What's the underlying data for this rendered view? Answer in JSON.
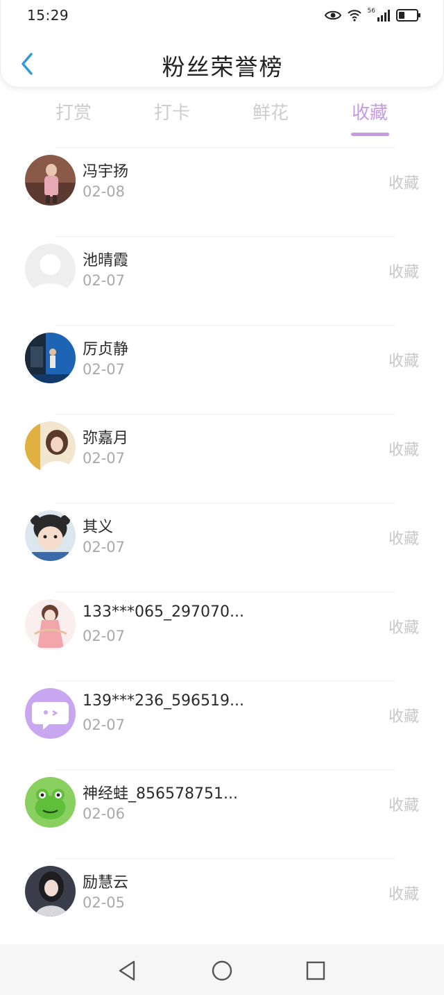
{
  "status_bar": {
    "time": "15:29",
    "network": "56",
    "icons": [
      "eye-icon",
      "wifi-icon",
      "signal-icon",
      "battery-icon"
    ]
  },
  "header": {
    "back_icon": "chevron-left-icon",
    "title": "粉丝荣誉榜"
  },
  "tabs": [
    {
      "label": "打赏",
      "active": false
    },
    {
      "label": "打卡",
      "active": false
    },
    {
      "label": "鲜花",
      "active": false
    },
    {
      "label": "收藏",
      "active": true
    }
  ],
  "colors": {
    "accent": "#c59be4",
    "back_arrow": "#2e9ad8",
    "inactive_tab": "#cdcdcd"
  },
  "fans": [
    {
      "name": "冯宇扬",
      "date": "02-08",
      "action": "收藏",
      "avatar": "photo-avatar"
    },
    {
      "name": "池晴霞",
      "date": "02-07",
      "action": "收藏",
      "avatar": "default-avatar"
    },
    {
      "name": "厉贞静",
      "date": "02-07",
      "action": "收藏",
      "avatar": "photo-avatar"
    },
    {
      "name": "弥嘉月",
      "date": "02-07",
      "action": "收藏",
      "avatar": "photo-avatar"
    },
    {
      "name": "其义",
      "date": "02-07",
      "action": "收藏",
      "avatar": "photo-avatar"
    },
    {
      "name": "133***065_297070...",
      "date": "02-07",
      "action": "收藏",
      "avatar": "illustration-avatar"
    },
    {
      "name": "139***236_596519...",
      "date": "02-07",
      "action": "收藏",
      "avatar": "chat-bubble-avatar"
    },
    {
      "name": "神经蛙_856578751...",
      "date": "02-06",
      "action": "收藏",
      "avatar": "frog-avatar"
    },
    {
      "name": "励慧云",
      "date": "02-05",
      "action": "收藏",
      "avatar": "photo-avatar"
    }
  ],
  "nav_bar": [
    "back-triangle-icon",
    "home-circle-icon",
    "recents-square-icon"
  ]
}
